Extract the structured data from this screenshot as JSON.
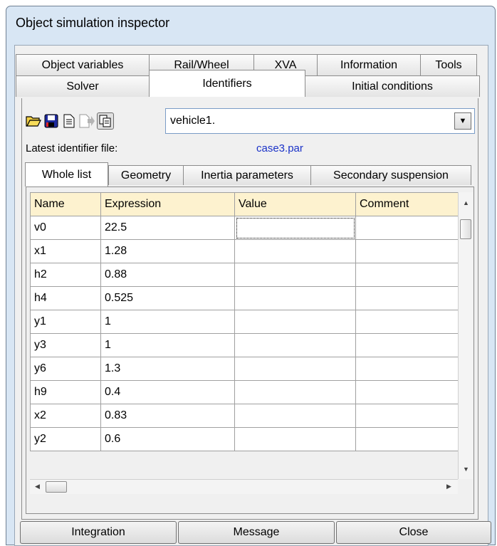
{
  "window": {
    "title": "Object simulation inspector"
  },
  "tabs_row1": [
    {
      "label": "Object variables"
    },
    {
      "label": "Rail/Wheel"
    },
    {
      "label": "XVA"
    },
    {
      "label": "Information"
    },
    {
      "label": "Tools"
    }
  ],
  "tabs_row2": [
    {
      "label": "Solver"
    },
    {
      "label": "Identifiers"
    },
    {
      "label": "Initial conditions"
    }
  ],
  "toolbar": {
    "icons": [
      "open-folder-icon",
      "save-icon",
      "document-icon",
      "export-icon",
      "copy-icon"
    ],
    "object_select": "vehicle1."
  },
  "latest": {
    "label": "Latest identifier file:",
    "file": "case3.par"
  },
  "subtabs": [
    {
      "label": "Whole list"
    },
    {
      "label": "Geometry"
    },
    {
      "label": "Inertia parameters"
    },
    {
      "label": "Secondary suspension"
    }
  ],
  "grid": {
    "headers": [
      "Name",
      "Expression",
      "Value",
      "Comment"
    ],
    "rows": [
      [
        "v0",
        "22.5",
        "",
        ""
      ],
      [
        "x1",
        "1.28",
        "",
        ""
      ],
      [
        "h2",
        "0.88",
        "",
        ""
      ],
      [
        "h4",
        "0.525",
        "",
        ""
      ],
      [
        "y1",
        "1",
        "",
        ""
      ],
      [
        "y3",
        "1",
        "",
        ""
      ],
      [
        "y6",
        "1.3",
        "",
        ""
      ],
      [
        "h9",
        "0.4",
        "",
        ""
      ],
      [
        "x2",
        "0.83",
        "",
        ""
      ],
      [
        "y2",
        "0.6",
        "",
        ""
      ]
    ]
  },
  "buttons": {
    "integration": "Integration",
    "message": "Message",
    "close": "Close"
  },
  "colors": {
    "header_bg": "#fdf2cf",
    "latest_file": "#1a32c8"
  }
}
